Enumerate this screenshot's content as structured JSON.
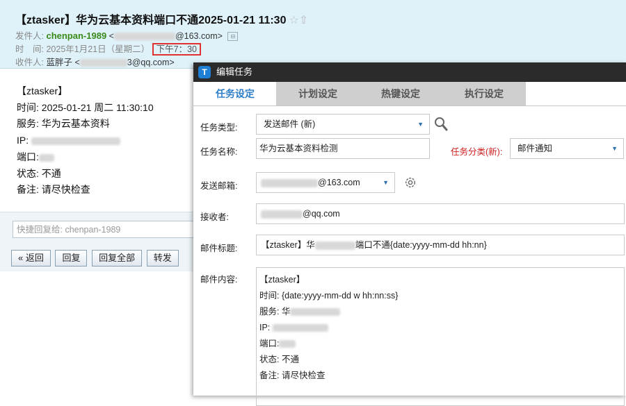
{
  "mail": {
    "subject": "【ztasker】华为云基本资料端口不通2025-01-21 11:30",
    "star_icon": "☆",
    "flag_icon": "⇧",
    "sender_label": "发件人:",
    "sender_name": "chenpan-1989",
    "sender_email_suffix": "@163.com>",
    "time_label": "时　间:",
    "time_date": "2025年1月21日（星期二）",
    "time_clock": "下午7：30",
    "recipient_label": "收件人:",
    "recipient_name": "蓝胖子",
    "recipient_email_suffix": "3@qq.com>",
    "body_lines": [
      "【ztasker】",
      "时间: 2025-01-21 周二 11:30:10",
      "服务: 华为云基本资料",
      "IP:",
      "端口:",
      "状态: 不通",
      "备注: 请尽快检查"
    ],
    "quick_reply_placeholder": "快捷回复给: chenpan-1989",
    "buttons": [
      "« 返回",
      "回复",
      "回复全部",
      "转发"
    ]
  },
  "dialog": {
    "title": "编辑任务",
    "tabs": [
      "任务设定",
      "计划设定",
      "热键设定",
      "执行设定"
    ],
    "active_tab": 0,
    "task_type_label": "任务类型:",
    "task_type_value": "发送邮件 (新)",
    "task_name_label": "任务名称:",
    "task_name_value": "华为云基本资料检测",
    "task_category_label": "任务分类(新):",
    "task_category_value": "邮件通知",
    "send_mailbox_label": "发送邮箱:",
    "send_mailbox_suffix": "@163.com",
    "receiver_label": "接收者:",
    "receiver_suffix": "@qq.com",
    "mail_title_label": "邮件标题:",
    "mail_title_prefix": "【ztasker】华",
    "mail_title_suffix": "端口不通{date:yyyy-mm-dd hh:nn}",
    "mail_content_label": "邮件内容:",
    "mail_content_lines": [
      "【ztasker】",
      "时间: {date:yyyy-mm-dd w hh:nn:ss}",
      "服务: 华",
      "IP:",
      "端口:",
      "状态: 不通",
      "备注: 请尽快检查"
    ],
    "accent_color": "#2f7fc8",
    "category_label_color": "#d02020"
  }
}
